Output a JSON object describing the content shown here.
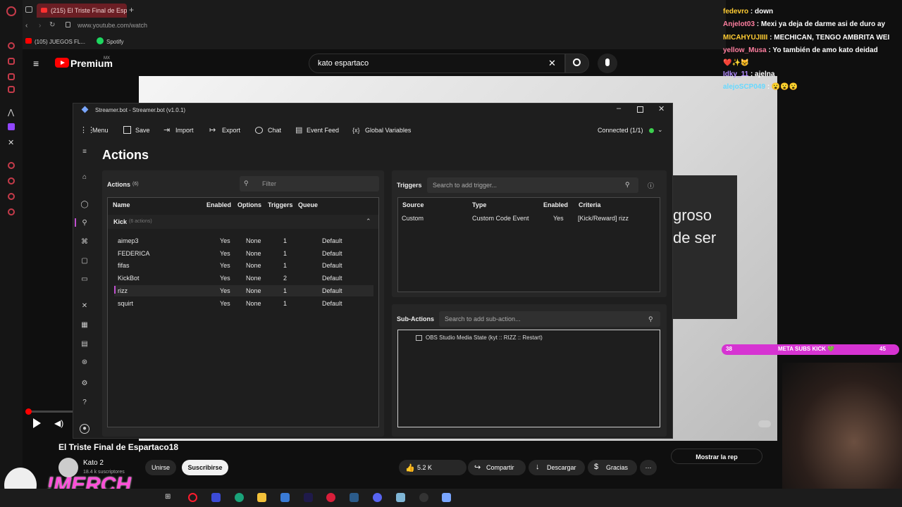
{
  "browser": {
    "tab_title": "(215) El Triste Final de Esp",
    "url": "www.youtube.com/watch",
    "bookmarks": [
      "(105) JUEGOS FL...",
      "Spotify"
    ]
  },
  "youtube": {
    "logo_text": "Premium",
    "region": "MX",
    "search_value": "kato espartaco",
    "video_overlay_1": "groso",
    "video_overlay_2": "de ser",
    "video_title": "El Triste Final de Espartaco18",
    "channel_name": "Kato 2",
    "channel_subs": "18.4 k suscriptores",
    "join_label": "Unirse",
    "subscribe_label": "Suscribirse",
    "likes": "5.2 K",
    "share_label": "Compartir",
    "download_label": "Descargar",
    "thanks_label": "Gracias",
    "show_chat": "Mostrar la rep"
  },
  "chat": [
    {
      "user": "fedevro",
      "text": ": down",
      "color": "#ffcc33"
    },
    {
      "user": "Anjelot03",
      "text": ": Mexi ya deja de darme asi de duro ay",
      "color": "#ff7fa0"
    },
    {
      "user": "MICAHYUJIIII",
      "text": ": MECHICAN, TENGO AMBRITA WEI",
      "color": "#ffcc33"
    },
    {
      "user": "yellow_Musa",
      "text": ": Yo también de amo kato deidad",
      "color": "#ff7fa0"
    },
    {
      "user": "Idky_11",
      "text": ": ajelna",
      "color": "#b38cff"
    },
    {
      "user": "alejoSCP049",
      "text": ": 😮😮😮",
      "color": "#66d9ff"
    }
  ],
  "subs_goal": {
    "current": "38",
    "label": "META SUBS KICK 💚",
    "target": "45"
  },
  "merch_text": "!MERCH",
  "streamerbot": {
    "title": "Streamer.bot - Streamer.bot (v1.0.1)",
    "toolbar": [
      "Menu",
      "Save",
      "Import",
      "Export",
      "Chat",
      "Event Feed",
      "Global Variables"
    ],
    "connected": "Connected (1/1)",
    "heading": "Actions",
    "actions_label": "Actions",
    "actions_count": "(6)",
    "filter_placeholder": "Filter",
    "columns": [
      "Name",
      "Enabled",
      "Options",
      "Triggers",
      "Queue"
    ],
    "group": {
      "name": "Kick",
      "sub": "(6 actions)"
    },
    "rows": [
      {
        "name": "aimep3",
        "enabled": "Yes",
        "options": "None",
        "triggers": "1",
        "queue": "Default"
      },
      {
        "name": "FEDERICA",
        "enabled": "Yes",
        "options": "None",
        "triggers": "1",
        "queue": "Default"
      },
      {
        "name": "fifas",
        "enabled": "Yes",
        "options": "None",
        "triggers": "1",
        "queue": "Default"
      },
      {
        "name": "KickBot",
        "enabled": "Yes",
        "options": "None",
        "triggers": "2",
        "queue": "Default"
      },
      {
        "name": "rizz",
        "enabled": "Yes",
        "options": "None",
        "triggers": "1",
        "queue": "Default"
      },
      {
        "name": "squirt",
        "enabled": "Yes",
        "options": "None",
        "triggers": "1",
        "queue": "Default"
      }
    ],
    "triggers_label": "Triggers",
    "triggers_placeholder": "Search to add trigger...",
    "trigger_columns": [
      "Source",
      "Type",
      "Enabled",
      "Criteria"
    ],
    "trigger_row": {
      "source": "Custom",
      "type": "Custom Code Event",
      "enabled": "Yes",
      "criteria": "[Kick/Reward] rizz"
    },
    "subactions_label": "Sub-Actions",
    "subactions_placeholder": "Search to add sub-action...",
    "subaction_item": "OBS Studio Media State (kyt :: RIZZ :: Restart)"
  }
}
